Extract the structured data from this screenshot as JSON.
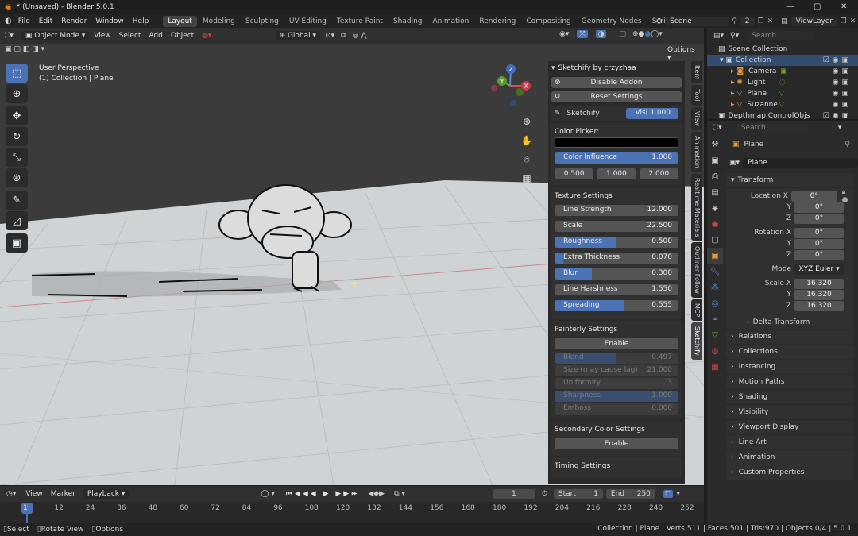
{
  "window": {
    "title": "* (Unsaved) - Blender 5.0.1"
  },
  "menus": [
    "File",
    "Edit",
    "Render",
    "Window",
    "Help"
  ],
  "workspaces": [
    "Layout",
    "Modeling",
    "Sculpting",
    "UV Editing",
    "Texture Paint",
    "Shading",
    "Animation",
    "Rendering",
    "Compositing",
    "Geometry Nodes",
    "Scripting"
  ],
  "scene": {
    "name": "Scene",
    "count": "2",
    "view_layer": "ViewLayer"
  },
  "viewport": {
    "mode": "Object Mode",
    "menus": [
      "View",
      "Select",
      "Add",
      "Object"
    ],
    "transform_orientation": "Global",
    "options_label": "Options",
    "overlay_text": [
      "User Perspective",
      "(1) Collection | Plane"
    ],
    "gizmo_axes": {
      "z": "Z",
      "y": "Y",
      "x": "X"
    }
  },
  "sidebar_tabs": [
    "Item",
    "Tool",
    "View",
    "Animation",
    "Realtime Materials",
    "Outliner Follow",
    "MCP",
    "Sketchify"
  ],
  "sketchify": {
    "panel_title": "Sketchify by crzyzhaa",
    "disable_addon": "Disable Addon",
    "reset_settings": "Reset Settings",
    "sketchify_label": "Sketchify",
    "visibility": {
      "label": "Visi...",
      "value": "1.000"
    },
    "color_picker_label": "Color Picker:",
    "color_picker_value": "#000000",
    "color_influence": {
      "label": "Color Influence",
      "value": "1.000",
      "fraction": 1.0
    },
    "rgb_values": [
      "0.500",
      "1.000",
      "2.000"
    ],
    "texture_settings": {
      "title": "Texture Settings",
      "sliders": [
        {
          "label": "Line Strength",
          "value": "12.000",
          "fraction": 0.0
        },
        {
          "label": "Scale",
          "value": "22.500",
          "fraction": 0.0
        },
        {
          "label": "Roughness",
          "value": "0.500",
          "fraction": 0.5
        },
        {
          "label": "Extra Thickness",
          "value": "0.070",
          "fraction": 0.07
        },
        {
          "label": "Blur",
          "value": "0.300",
          "fraction": 0.3
        },
        {
          "label": "Line Harshness",
          "value": "1.550",
          "fraction": 0.0
        },
        {
          "label": "Spreading",
          "value": "0.555",
          "fraction": 0.555
        }
      ]
    },
    "painterly_settings": {
      "title": "Painterly Settings",
      "enable": "Enable",
      "sliders": [
        {
          "label": "Blend",
          "value": "0.497",
          "fraction": 0.497
        },
        {
          "label": "Size (may cause lag)",
          "value": "21.000",
          "fraction": 0.0
        },
        {
          "label": "Uniformity",
          "value": "3",
          "fraction": 0.0
        },
        {
          "label": "Sharpness",
          "value": "1.000",
          "fraction": 1.0
        },
        {
          "label": "Emboss",
          "value": "0.000",
          "fraction": 0.0
        }
      ]
    },
    "secondary_color": {
      "title": "Secondary Color Settings",
      "enable": "Enable"
    },
    "timing_settings": {
      "title": "Timing Settings"
    }
  },
  "timeline": {
    "menus": [
      "View",
      "Marker",
      "Playback"
    ],
    "current_frame": "1",
    "start_label": "Start",
    "start": "1",
    "end_label": "End",
    "end": "250",
    "ticks": [
      "1",
      "12",
      "24",
      "36",
      "48",
      "60",
      "72",
      "84",
      "96",
      "108",
      "120",
      "132",
      "144",
      "156",
      "168",
      "180",
      "192",
      "204",
      "216",
      "228",
      "240",
      "252"
    ]
  },
  "statusbar": {
    "hints": [
      "Select",
      "Rotate View",
      "Options"
    ],
    "info": "Collection | Plane | Verts:511 | Faces:501 | Tris:970 | Objects:0/4 | 5.0.1"
  },
  "outliner": {
    "search_placeholder": "Search",
    "root": "Scene Collection",
    "collection": "Collection",
    "items": [
      {
        "name": "Camera",
        "icon": "camera-icon"
      },
      {
        "name": "Light",
        "icon": "light-icon"
      },
      {
        "name": "Plane",
        "icon": "mesh-icon"
      },
      {
        "name": "Suzanne",
        "icon": "mesh-icon"
      }
    ],
    "extra_collection": "Depthmap ControlObjs"
  },
  "properties": {
    "search_placeholder": "Search",
    "object_name": "Plane",
    "data_name": "Plane",
    "transform_title": "Transform",
    "location": {
      "label": "Location X",
      "y_label": "Y",
      "z_label": "Z",
      "x": "0°",
      "y": "0°",
      "z": "0°"
    },
    "rotation": {
      "label": "Rotation X",
      "y_label": "Y",
      "z_label": "Z",
      "x": "0°",
      "y": "0°",
      "z": "0°"
    },
    "mode": {
      "label": "Mode",
      "value": "XYZ Euler"
    },
    "scale": {
      "label": "Scale X",
      "y_label": "Y",
      "z_label": "Z",
      "x": "16.320",
      "y": "16.320",
      "z": "16.320"
    },
    "delta_transform": "Delta Transform",
    "sections": [
      "Relations",
      "Collections",
      "Instancing",
      "Motion Paths",
      "Shading",
      "Visibility",
      "Viewport Display",
      "Line Art",
      "Animation",
      "Custom Properties"
    ]
  },
  "colors": {
    "accent": "#4a72b5",
    "panel": "#303030",
    "viewport_floor": "#cfd3d6",
    "viewport_sky": "#3b3b3b"
  }
}
